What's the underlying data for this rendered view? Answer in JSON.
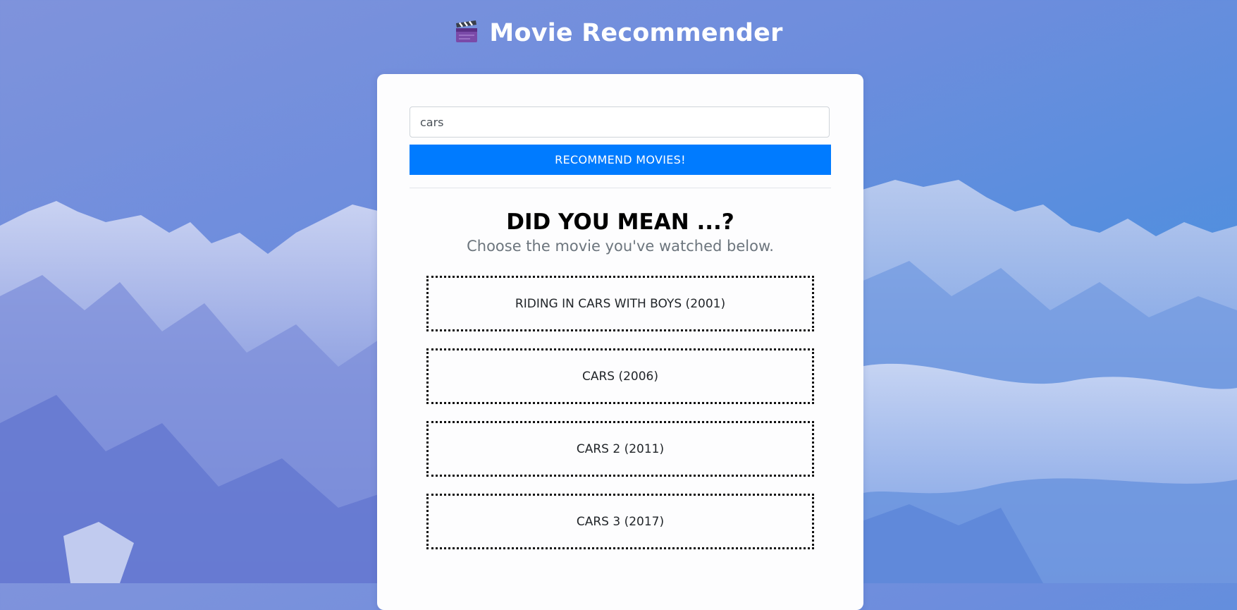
{
  "header": {
    "icon": "clapper-board-icon",
    "title": "Movie Recommender"
  },
  "search": {
    "value": "cars"
  },
  "recommend_button": {
    "label": "RECOMMEND MOVIES!"
  },
  "suggestions": {
    "title": "DID YOU MEAN ...?",
    "subtitle": "Choose the movie you've watched below.",
    "movies": [
      "RIDING IN CARS WITH BOYS (2001)",
      "CARS (2006)",
      "CARS 2 (2011)",
      "CARS 3 (2017)"
    ]
  },
  "colors": {
    "accent": "#007bff",
    "subtitle": "#6c757d"
  }
}
